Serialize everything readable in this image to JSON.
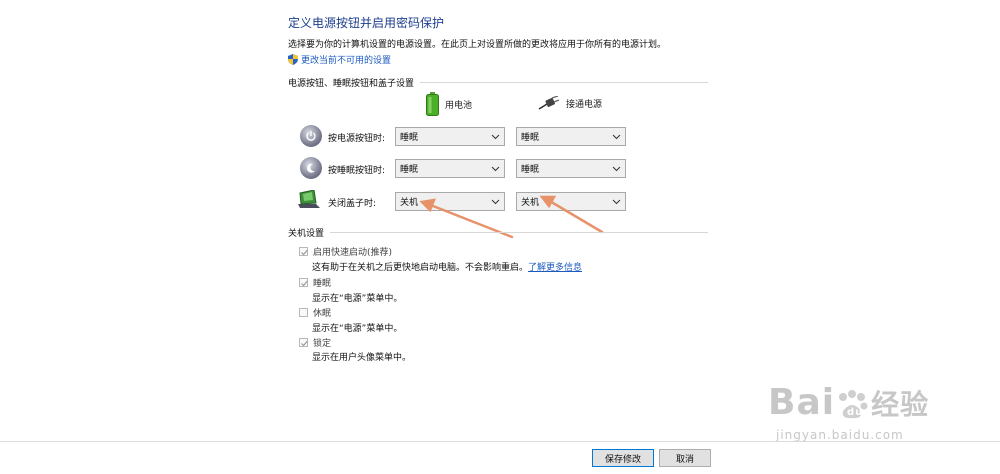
{
  "page": {
    "title": "定义电源按钮并启用密码保护",
    "description": "选择要为你的计算机设置的电源设置。在此页上对设置所做的更改将应用于你所有的电源计划。",
    "change_link": "更改当前不可用的设置"
  },
  "power_section": {
    "heading": "电源按钮、睡眠按钮和盖子设置",
    "columns": {
      "battery": "用电池",
      "plugged": "接通电源"
    },
    "rows": [
      {
        "label": "按电源按钮时:",
        "battery": "睡眠",
        "plugged": "睡眠"
      },
      {
        "label": "按睡眠按钮时:",
        "battery": "睡眠",
        "plugged": "睡眠"
      },
      {
        "label": "关闭盖子时:",
        "battery": "关机",
        "plugged": "关机"
      }
    ]
  },
  "shutdown_section": {
    "heading": "关机设置",
    "items": [
      {
        "label": "启用快速启动(推荐)",
        "checked": true,
        "description": "这有助于在关机之后更快地启动电脑。不会影响重启。",
        "link": "了解更多信息"
      },
      {
        "label": "睡眠",
        "checked": true,
        "description": "显示在“电源”菜单中。"
      },
      {
        "label": "休眠",
        "checked": false,
        "description": "显示在“电源”菜单中。"
      },
      {
        "label": "锁定",
        "checked": true,
        "description": "显示在用户头像菜单中。"
      }
    ]
  },
  "footer": {
    "save": "保存修改",
    "cancel": "取消"
  },
  "watermark": {
    "brand": "Bai",
    "brand_cn": "经验",
    "url": "jingyan.baidu.com"
  },
  "colors": {
    "title": "#1c3e8c",
    "link": "#1c5bbd",
    "arrow": "#e8926a",
    "button_focus": "#0078d7"
  }
}
